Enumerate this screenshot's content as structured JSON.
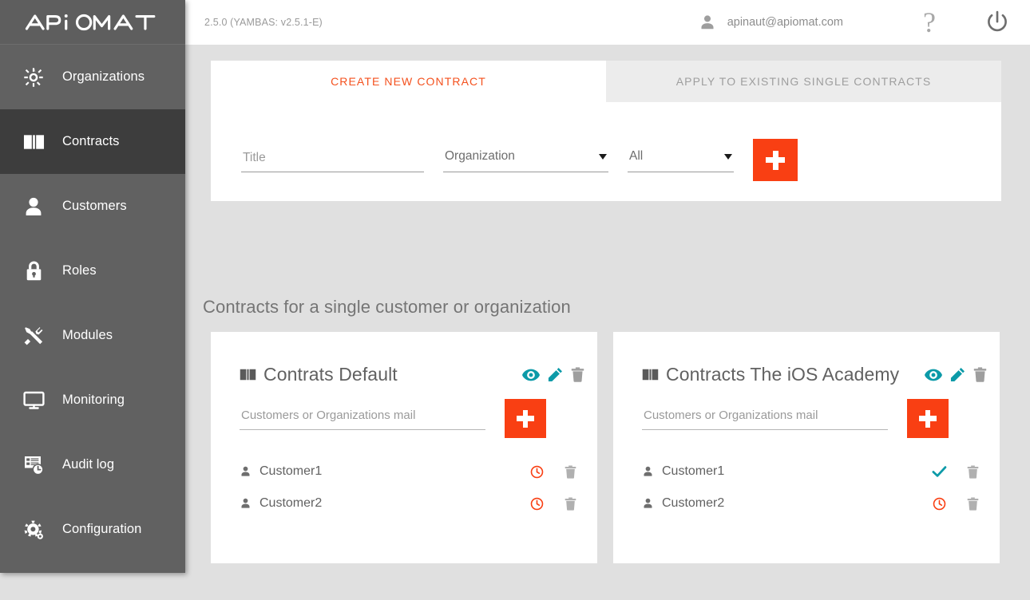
{
  "app": {
    "logo_text": "APiOMAT",
    "accent_orange": "#f93f13",
    "accent_teal": "#0c9aa8",
    "sidebar_bg": "#616161",
    "sidebar_active_bg": "#3d3d3d",
    "content_bg": "#e0e0e0"
  },
  "topbar": {
    "version": "2.5.0 (YAMBAS: v2.5.1-E)",
    "user_email": "apinaut@apiomat.com",
    "help_label": "?",
    "user_icon": "person-icon",
    "power_icon": "power-icon"
  },
  "sidebar": {
    "items": [
      {
        "label": "Organizations",
        "icon": "organizations-icon",
        "active": false
      },
      {
        "label": "Contracts",
        "icon": "book-icon",
        "active": true
      },
      {
        "label": "Customers",
        "icon": "person-icon",
        "active": false
      },
      {
        "label": "Roles",
        "icon": "lock-icon",
        "active": false
      },
      {
        "label": "Modules",
        "icon": "tools-icon",
        "active": false
      },
      {
        "label": "Monitoring",
        "icon": "monitor-icon",
        "active": false
      },
      {
        "label": "Audit log",
        "icon": "audit-log-icon",
        "active": false
      },
      {
        "label": "Configuration",
        "icon": "gear-icon",
        "active": false
      }
    ]
  },
  "panel": {
    "tabs": [
      {
        "label": "CREATE NEW CONTRACT",
        "active": true
      },
      {
        "label": "APPLY TO EXISTING SINGLE CONTRACTS",
        "active": false
      }
    ],
    "form": {
      "title_placeholder": "Title",
      "title_value": "",
      "organization_selected": "Organization",
      "scope_selected": "All",
      "add_button_label": "+"
    }
  },
  "main": {
    "section_title": "Contracts for a single customer or organization",
    "cards": [
      {
        "title": "Contrats Default",
        "mail_placeholder": "Customers or Organizations mail",
        "mail_value": "",
        "actions": [
          {
            "name": "view-icon",
            "color": "#0c9aa8"
          },
          {
            "name": "edit-icon",
            "color": "#0c9aa8"
          },
          {
            "name": "delete-icon",
            "color": "#9e9e9e"
          }
        ],
        "customers": [
          {
            "name": "Customer1",
            "status": "pending",
            "status_icon": "clock-icon"
          },
          {
            "name": "Customer2",
            "status": "pending",
            "status_icon": "clock-icon"
          }
        ]
      },
      {
        "title": "Contracts The iOS Academy",
        "mail_placeholder": "Customers or Organizations mail",
        "mail_value": "",
        "actions": [
          {
            "name": "view-icon",
            "color": "#0c9aa8"
          },
          {
            "name": "edit-icon",
            "color": "#0c9aa8"
          },
          {
            "name": "delete-icon",
            "color": "#9e9e9e"
          }
        ],
        "customers": [
          {
            "name": "Customer1",
            "status": "accepted",
            "status_icon": "check-icon"
          },
          {
            "name": "Customer2",
            "status": "pending",
            "status_icon": "clock-icon"
          }
        ]
      }
    ]
  }
}
